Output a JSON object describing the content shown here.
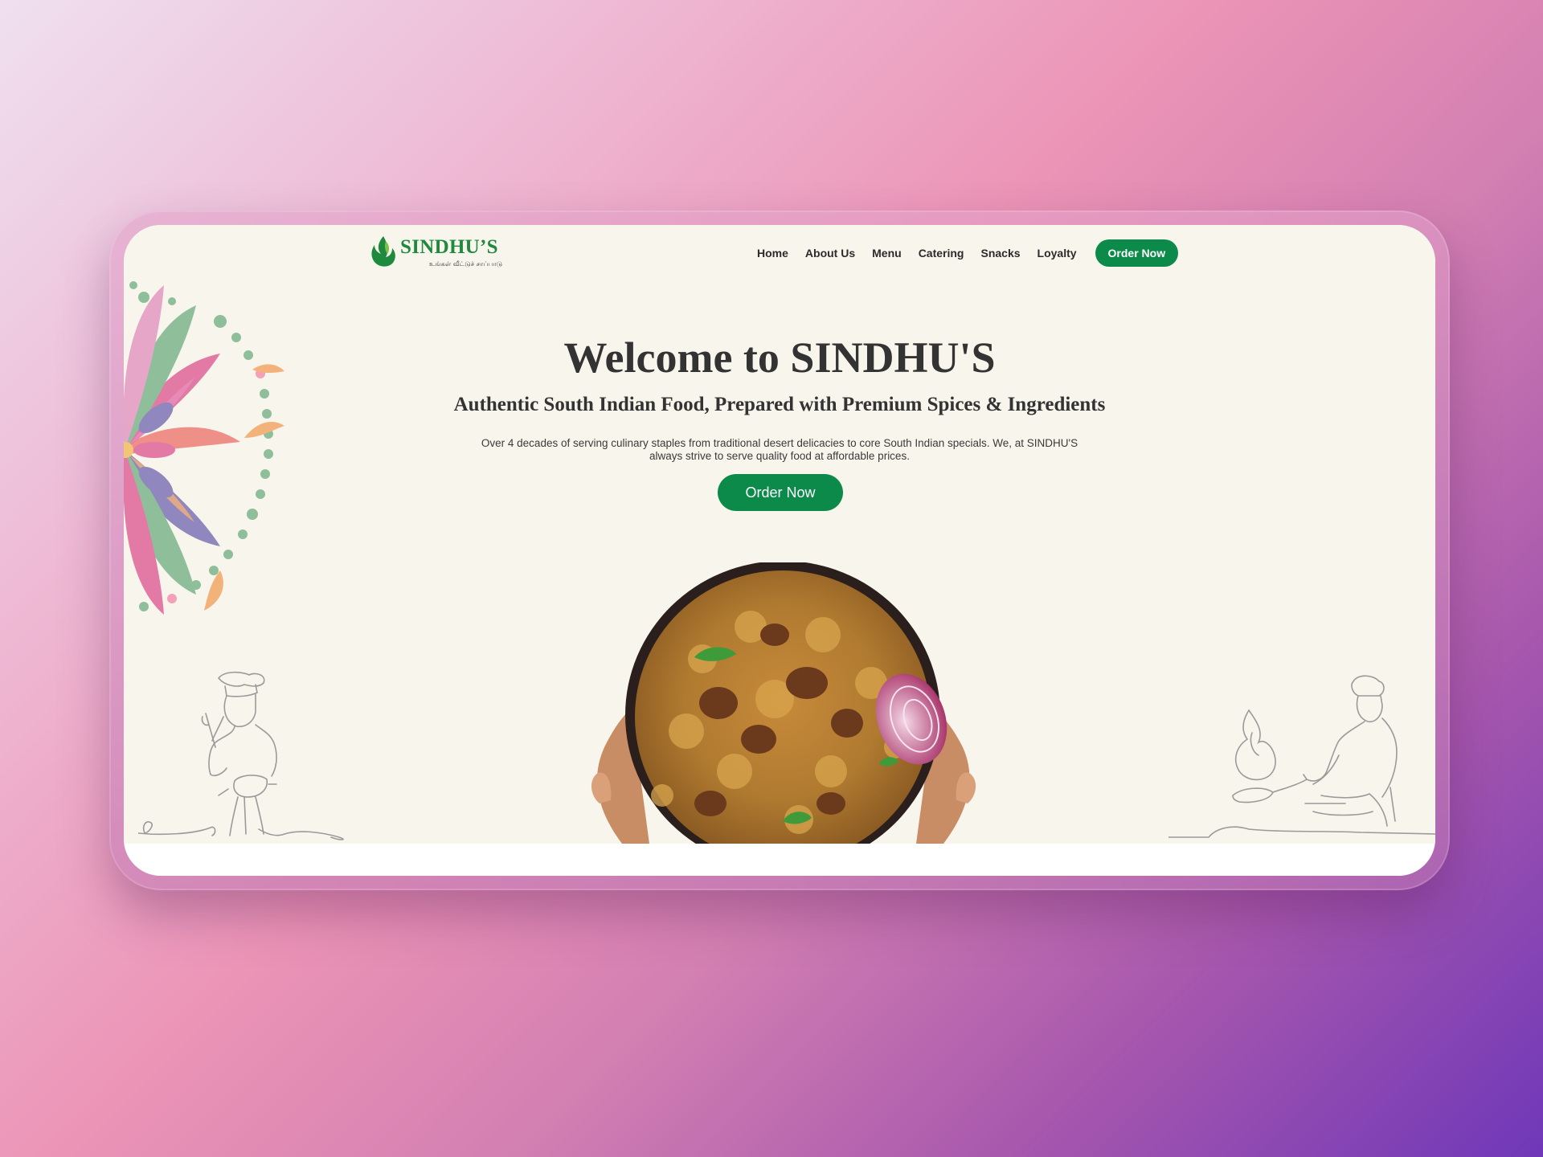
{
  "brand": {
    "name": "SINDHU’S",
    "tagline": "உங்கள் வீட்டுச் சாப்பாடு",
    "color": "#0b8a4a"
  },
  "nav": {
    "items": [
      {
        "label": "Home"
      },
      {
        "label": "About Us"
      },
      {
        "label": "Menu"
      },
      {
        "label": "Catering"
      },
      {
        "label": "Snacks"
      },
      {
        "label": "Loyalty"
      }
    ],
    "cta_label": "Order Now"
  },
  "hero": {
    "title": "Welcome to SINDHU'S",
    "subtitle": "Authentic South Indian Food, Prepared with Premium Spices & Ingredients",
    "description": "Over 4 decades of serving culinary staples from traditional desert delicacies to core South Indian specials. We, at SINDHU'S always strive to serve quality food at affordable prices.",
    "cta_label": "Order Now"
  },
  "icons": {
    "logo": "flame-leaf-logo-icon",
    "decor_left": "mandala-illustration",
    "chef_left": "chef-line-art-icon",
    "chef_right": "chef-cooking-line-art-icon",
    "dish": "biryani-bowl-image"
  }
}
